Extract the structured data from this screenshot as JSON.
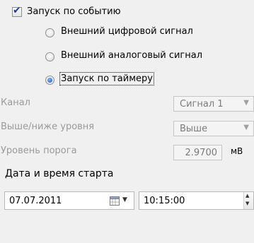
{
  "trigger_by_event": {
    "label": "Запуск по событию",
    "checked": true
  },
  "options": [
    {
      "label": "Внешний цифровой сигнал",
      "selected": false
    },
    {
      "label": "Внешний аналоговый сигнал",
      "selected": false
    },
    {
      "label": "Запуск по таймеру",
      "selected": true
    }
  ],
  "channel": {
    "label": "Канал",
    "value": "Сигнал 1"
  },
  "above_below": {
    "label": "Выше/ниже уровня",
    "value": "Выше"
  },
  "threshold": {
    "label": "Уровень порога",
    "value": "2.9700",
    "unit": "мВ"
  },
  "start": {
    "label": "Дата и время старта",
    "date": "07.07.2011",
    "time": "10:15:00"
  },
  "icons": {
    "calendar": "calendar-icon",
    "dropdown": "chevron-down-icon"
  }
}
